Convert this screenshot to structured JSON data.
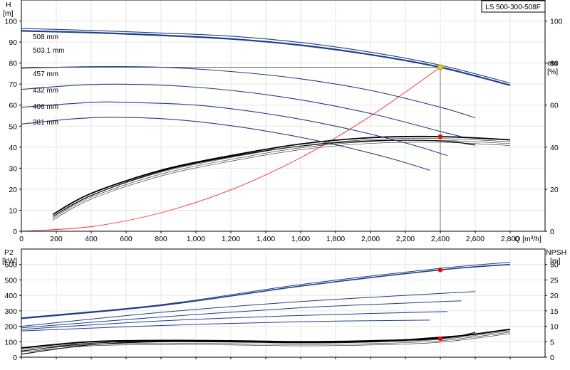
{
  "title_box": "LS 500-300-508F",
  "colors": {
    "impeller": "#1f3f8a",
    "efficiency": "#000000",
    "system": "#ff2a2a",
    "duty_marker": "#f5c400",
    "point_marker": "#ff0000",
    "grid": "#e6e6e6"
  },
  "chart_data": [
    {
      "type": "line",
      "name": "head",
      "ylabel_left": [
        "H",
        "[m]"
      ],
      "ylabel_right": [
        "eta",
        "[%]"
      ],
      "xlabel": "Q [m³/h]",
      "xlim": [
        0,
        3000
      ],
      "ylim": [
        0,
        110
      ],
      "ylim_right": [
        0,
        110
      ],
      "x_ticks": [
        0,
        200,
        400,
        600,
        800,
        1000,
        1200,
        1400,
        1600,
        1800,
        2000,
        2200,
        2400,
        2600,
        2800
      ],
      "x_tick_labels": [
        "0",
        "200",
        "400",
        "600",
        "800",
        "1,000",
        "1,200",
        "1,400",
        "1,600",
        "1,800",
        "2,000",
        "2,200",
        "2,400",
        "2,600",
        "2,800"
      ],
      "y_ticks": [
        0,
        10,
        20,
        30,
        40,
        50,
        60,
        70,
        80,
        90,
        100
      ],
      "y_right_ticks": [
        0,
        20,
        40,
        60,
        80,
        100
      ],
      "grid": true,
      "series": [
        {
          "name": "508 mm",
          "x": [
            0,
            400,
            800,
            1200,
            1600,
            2000,
            2400,
            2800
          ],
          "y": [
            96.5,
            95.5,
            94.3,
            92.8,
            89.8,
            85.2,
            79,
            70.5
          ]
        },
        {
          "name": "503.1 mm",
          "x": [
            0,
            400,
            800,
            1200,
            1600,
            2000,
            2400,
            2800
          ],
          "y": [
            95.3,
            94.5,
            93.2,
            91.5,
            88.5,
            84,
            78,
            69.5
          ]
        },
        {
          "name": "457 mm",
          "x": [
            0,
            400,
            800,
            1200,
            1600,
            2000,
            2400,
            2600
          ],
          "y": [
            77.5,
            78.3,
            78,
            76,
            72.5,
            67,
            59,
            54
          ]
        },
        {
          "name": "432 mm",
          "x": [
            0,
            400,
            800,
            1200,
            1600,
            2000,
            2400,
            2520
          ],
          "y": [
            67.5,
            69.8,
            69.5,
            67,
            62.5,
            56,
            47.5,
            45
          ]
        },
        {
          "name": "406 mm",
          "x": [
            0,
            400,
            600,
            1000,
            1400,
            1800,
            2200,
            2440
          ],
          "y": [
            59,
            61.3,
            61.3,
            60,
            56,
            50,
            42,
            36
          ]
        },
        {
          "name": "381 mm",
          "x": [
            0,
            300,
            550,
            900,
            1300,
            1700,
            2100,
            2340
          ],
          "y": [
            51,
            53.5,
            54.2,
            53,
            49,
            43,
            35,
            29
          ]
        }
      ],
      "efficiency": [
        {
          "x": [
            180,
            400,
            800,
            1200,
            1600,
            2000,
            2400,
            2800
          ],
          "y": [
            8,
            18,
            29,
            36,
            41.5,
            44.5,
            45,
            43.5
          ]
        },
        {
          "x": [
            180,
            400,
            800,
            1200,
            1600,
            2000,
            2400,
            2600
          ],
          "y": [
            7,
            17,
            28.5,
            35.5,
            40.5,
            43,
            43,
            41
          ]
        }
      ],
      "system_curve": {
        "x": [
          0,
          400,
          800,
          1200,
          1600,
          2000,
          2400
        ],
        "y": [
          0,
          2.2,
          8.8,
          19.7,
          35,
          54.8,
          78
        ]
      },
      "duty_point": {
        "x": 2400,
        "y": 78
      },
      "eta_point": {
        "x": 2400,
        "y": 45
      }
    },
    {
      "type": "line",
      "name": "power",
      "ylabel_left": [
        "P2",
        "[kW]"
      ],
      "ylabel_right": [
        "NPSH",
        "[m]"
      ],
      "xlim": [
        0,
        3000
      ],
      "ylim": [
        0,
        700
      ],
      "ylim_right": [
        0,
        35
      ],
      "y_ticks": [
        0,
        100,
        200,
        300,
        400,
        500,
        600
      ],
      "y_right_ticks": [
        0,
        5,
        10,
        15,
        20,
        25,
        30
      ],
      "series": [
        {
          "name": "508 mm",
          "x": [
            0,
            800,
            1600,
            2400,
            2800
          ],
          "y": [
            255,
            340,
            470,
            575,
            615
          ]
        },
        {
          "name": "503.1 mm",
          "x": [
            0,
            800,
            1600,
            2400,
            2800
          ],
          "y": [
            250,
            335,
            460,
            565,
            600
          ]
        },
        {
          "name": "457 mm",
          "x": [
            0,
            800,
            1600,
            2200,
            2600
          ],
          "y": [
            200,
            290,
            360,
            400,
            425
          ]
        },
        {
          "name": "432 mm",
          "x": [
            0,
            800,
            1600,
            2200,
            2520
          ],
          "y": [
            190,
            260,
            320,
            350,
            365
          ]
        },
        {
          "name": "406 mm",
          "x": [
            0,
            800,
            1600,
            2440
          ],
          "y": [
            180,
            235,
            270,
            295
          ]
        },
        {
          "name": "381 mm",
          "x": [
            0,
            800,
            1600,
            2340
          ],
          "y": [
            170,
            205,
            230,
            240
          ]
        }
      ],
      "npsh": [
        {
          "x": [
            0,
            400,
            800,
            1200,
            1600,
            2000,
            2400,
            2800
          ],
          "y": [
            3,
            5,
            5.4,
            5.3,
            5,
            5.3,
            6.2,
            9
          ]
        },
        {
          "x": [
            0,
            400,
            800,
            1200,
            1600,
            2000,
            2400,
            2600
          ],
          "y": [
            2,
            4.5,
            5.2,
            5.1,
            4.8,
            5.1,
            6,
            8
          ]
        },
        {
          "x": [
            0,
            400,
            800,
            1200,
            1600,
            2000,
            2520
          ],
          "y": [
            1,
            4,
            5,
            5,
            4.7,
            5,
            7
          ]
        }
      ],
      "power_point": {
        "x": 2400,
        "y": 565
      },
      "npsh_point": {
        "x": 2400,
        "y": 6
      }
    }
  ]
}
